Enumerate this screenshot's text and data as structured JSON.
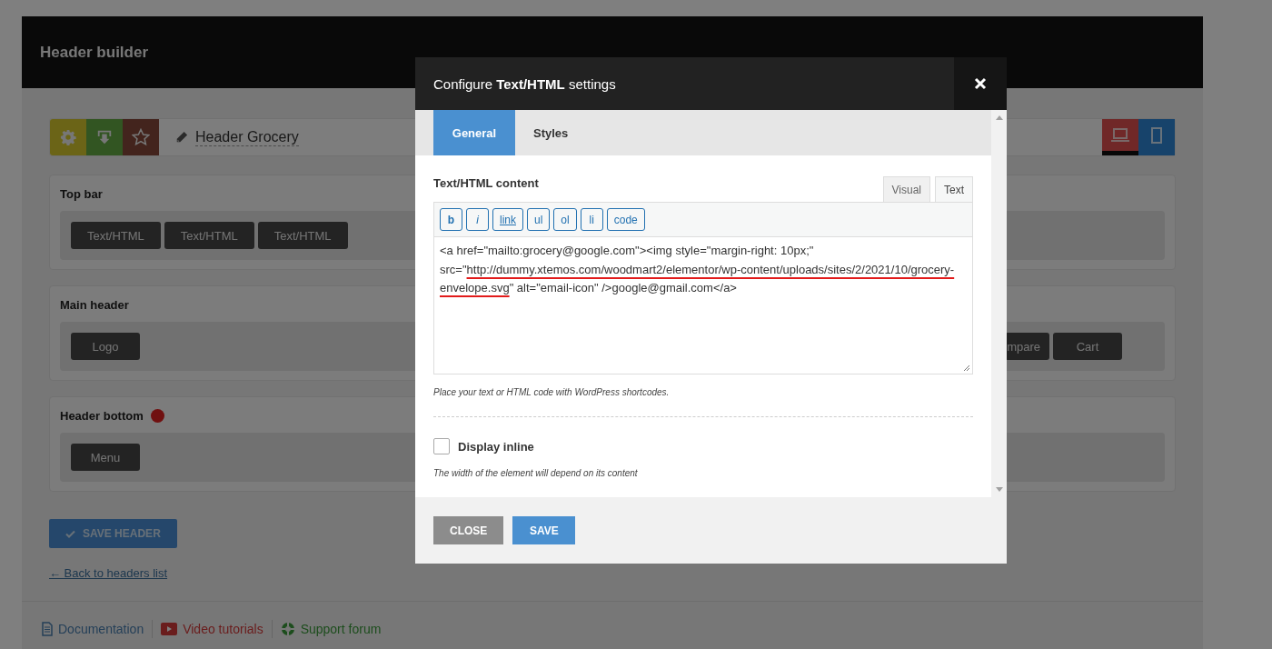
{
  "page": {
    "title": "Header builder",
    "actions": [
      {
        "kind": "settings"
      },
      {
        "kind": "import"
      },
      {
        "kind": "star"
      }
    ],
    "header_name": "Header Grocery",
    "devices": [
      {
        "kind": "desktop",
        "selected": true
      },
      {
        "kind": "mobile",
        "selected": false
      }
    ],
    "sections": [
      {
        "title": "Top bar",
        "marker": false,
        "left": [
          "Text/HTML",
          "Text/HTML",
          "Text/HTML"
        ]
      },
      {
        "title": "Main header",
        "marker": false,
        "left": [
          "Logo"
        ],
        "right": [
          "mpare",
          "Cart"
        ]
      },
      {
        "title": "Header bottom",
        "marker": true,
        "left": [
          "Menu"
        ]
      }
    ],
    "save_button": "SAVE HEADER",
    "back_link": "← Back to headers list",
    "footer_links": [
      {
        "kind": "docs",
        "label": "Documentation"
      },
      {
        "kind": "video",
        "label": "Video tutorials"
      },
      {
        "kind": "support",
        "label": "Support forum"
      }
    ]
  },
  "modal": {
    "title": "Configure **Text/HTML** settings",
    "tabs": [
      {
        "label": "General",
        "selected": true
      },
      {
        "label": "Styles",
        "selected": false
      }
    ],
    "field_label": "Text/HTML content",
    "editor_tabs": [
      {
        "label": "Visual",
        "selected": false
      },
      {
        "label": "Text",
        "selected": true
      }
    ],
    "quicktags": [
      {
        "kind": "bold",
        "label": "b"
      },
      {
        "kind": "italic",
        "label": "i"
      },
      {
        "kind": "link",
        "label": "link"
      },
      {
        "kind": "plain",
        "label": "ul"
      },
      {
        "kind": "plain",
        "label": "ol"
      },
      {
        "kind": "plain",
        "label": "li"
      },
      {
        "kind": "plain",
        "label": "code"
      }
    ],
    "content": {
      "before": "<a href=\"mailto:grocery@google.com\"><img style=\"margin-right: 10px;\" src=\"",
      "underlined": "http://dummy.xtemos.com/woodmart2/elementor/wp-content/uploads/sites/2/2021/10/grocery-envelope.svg",
      "after": "\" alt=\"email-icon\" />google@gmail.com</a>"
    },
    "hint": "Place your text or HTML code with WordPress shortcodes.",
    "option": {
      "label": "Display inline",
      "checked": false
    },
    "option_hint": "The width of the element will depend on its content",
    "buttons": [
      {
        "kind": "close",
        "label": "CLOSE"
      },
      {
        "kind": "save",
        "label": "SAVE"
      }
    ]
  }
}
